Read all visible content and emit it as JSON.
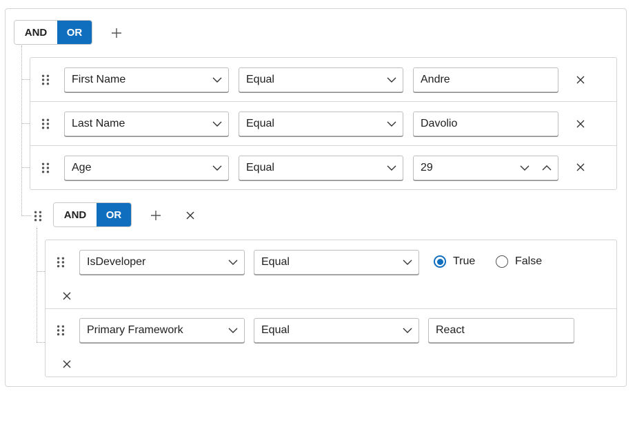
{
  "root_group": {
    "condition_and": "AND",
    "condition_or": "OR",
    "selected_condition": "OR",
    "rules": [
      {
        "field": "First Name",
        "operator": "Equal",
        "value": "Andre"
      },
      {
        "field": "Last Name",
        "operator": "Equal",
        "value": "Davolio"
      },
      {
        "field": "Age",
        "operator": "Equal",
        "value": "29"
      }
    ]
  },
  "nested_group": {
    "condition_and": "AND",
    "condition_or": "OR",
    "selected_condition": "OR",
    "rules": [
      {
        "field": "IsDeveloper",
        "operator": "Equal",
        "radio_true": "True",
        "radio_false": "False",
        "selected": "True"
      },
      {
        "field": "Primary Framework",
        "operator": "Equal",
        "value": "React"
      }
    ]
  },
  "colors": {
    "accent": "#106ebe",
    "border": "#d4d4d4"
  },
  "icons": {
    "add": "plus-icon",
    "remove": "close-icon",
    "drag": "drag-handle-icon",
    "dropdown": "chevron-down-icon",
    "spin_up": "chevron-up-icon"
  }
}
